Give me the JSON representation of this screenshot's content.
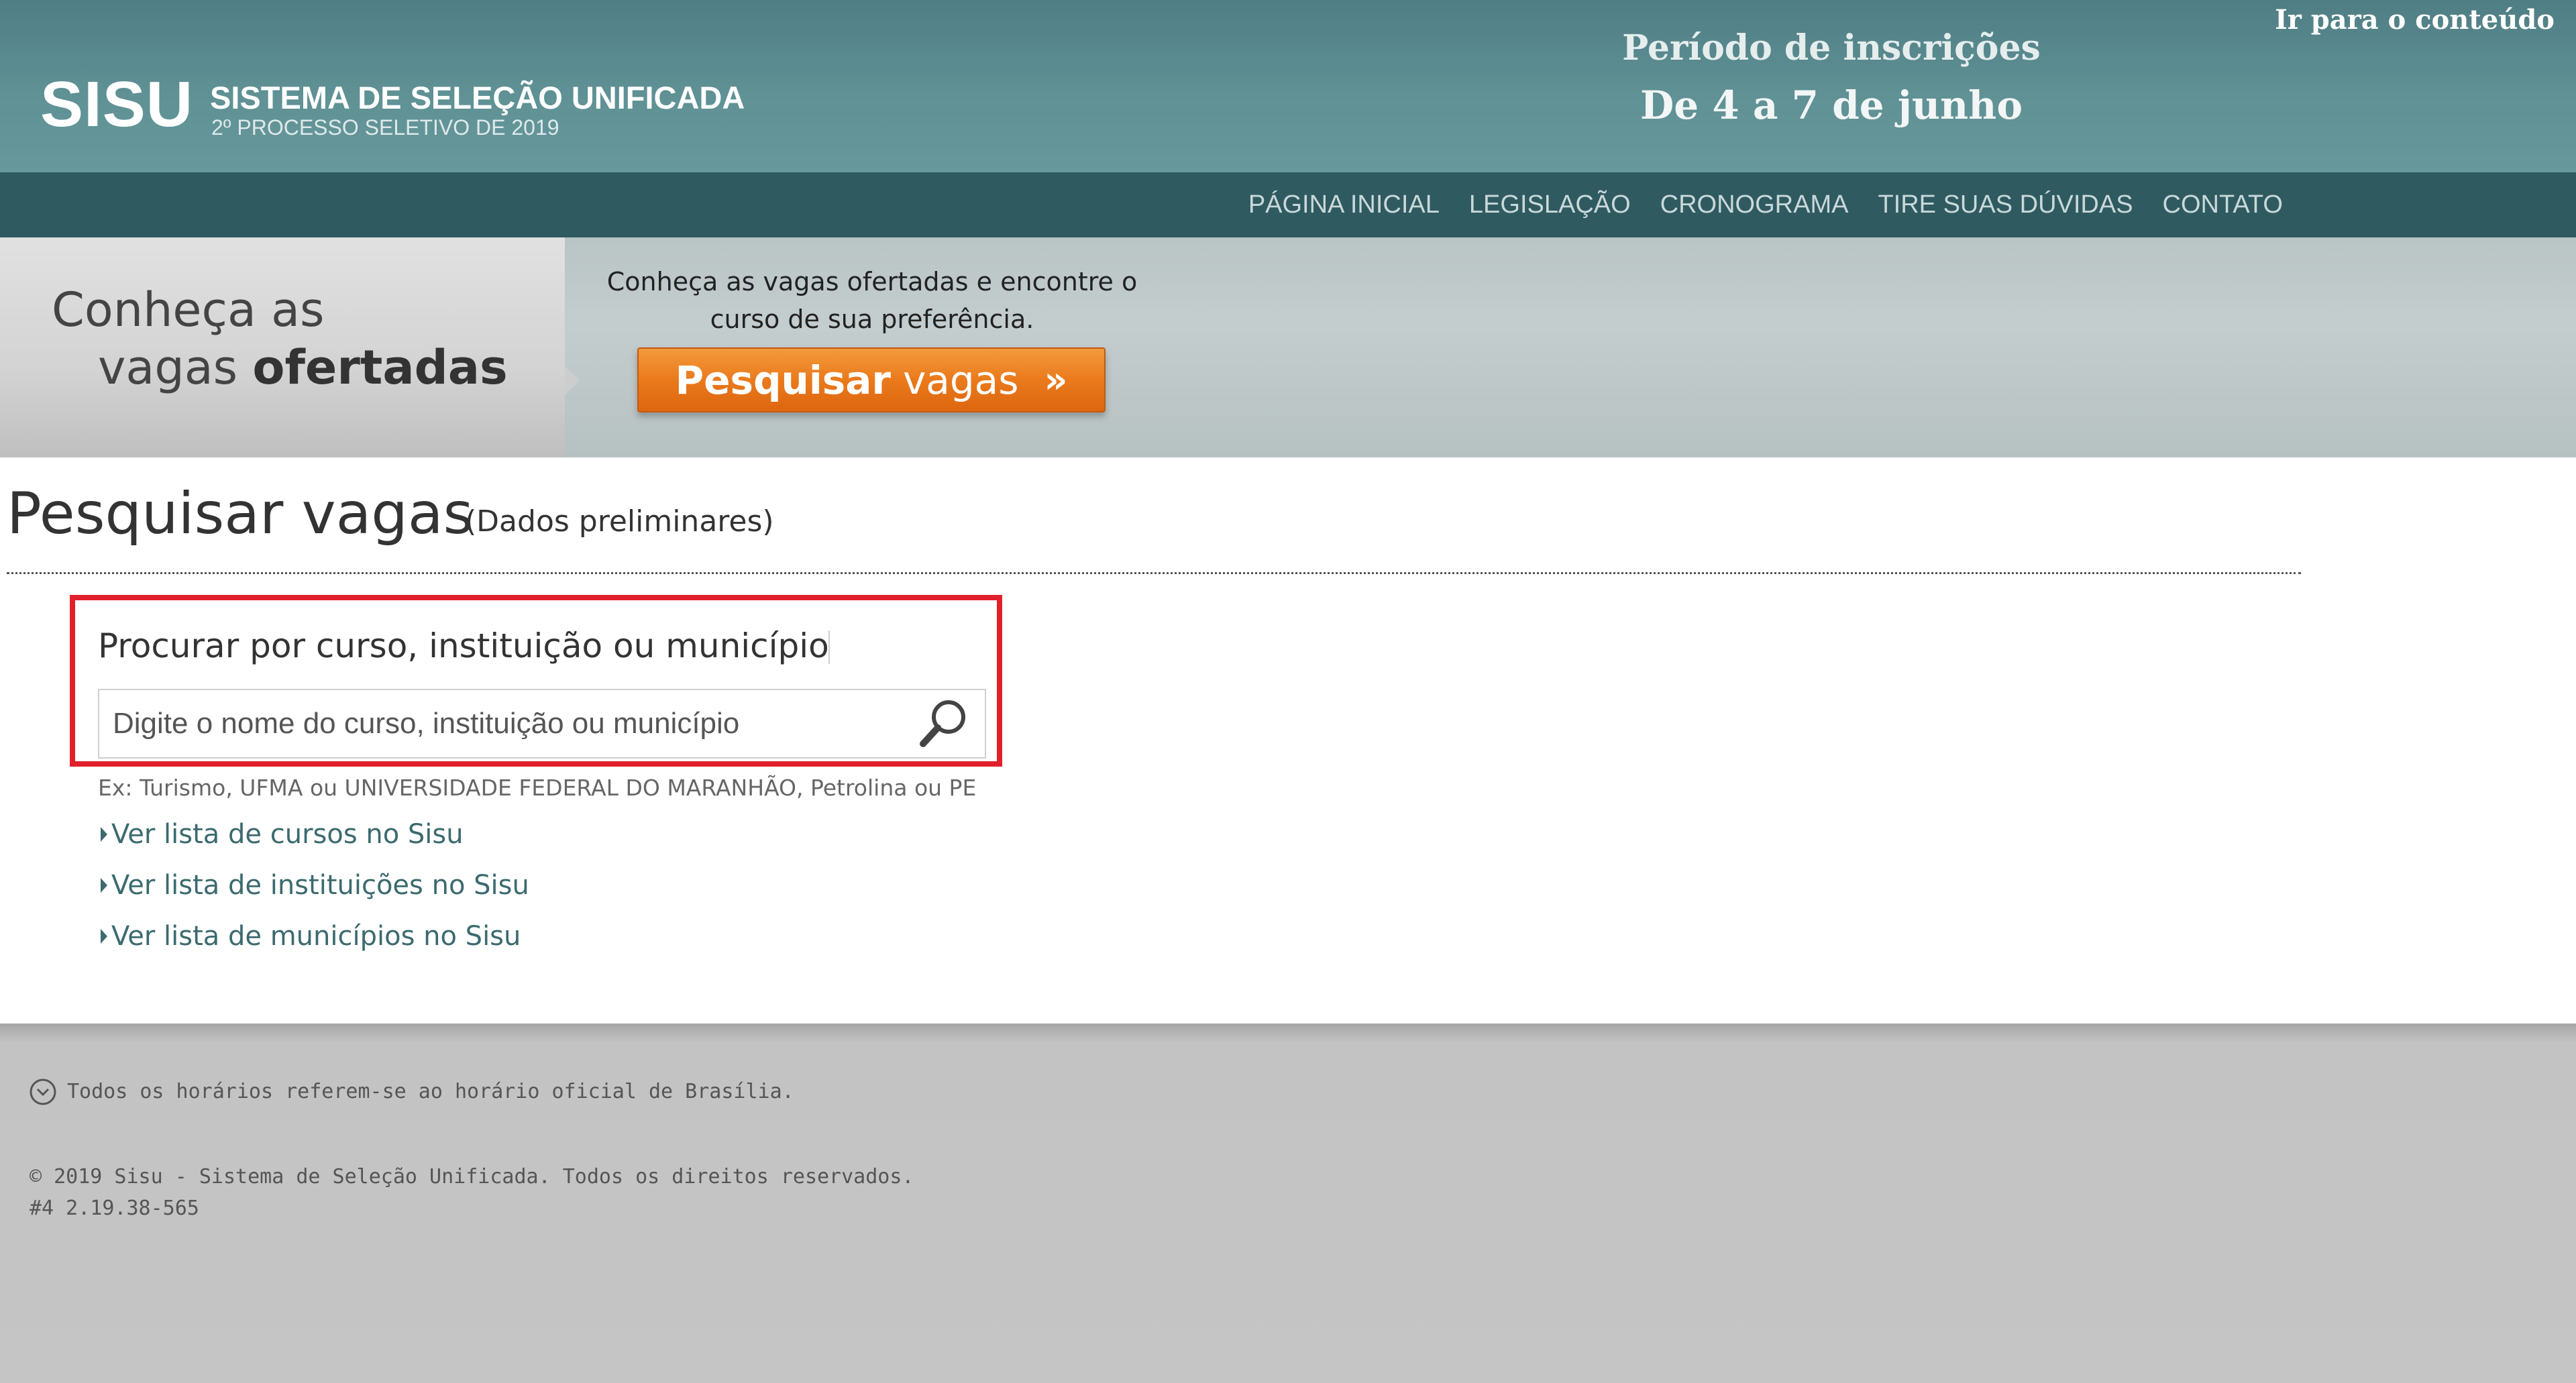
{
  "header": {
    "logo_text": "SISU",
    "system_name": "SISTEMA DE SELEÇÃO UNIFICADA",
    "process_subtitle": "2º PROCESSO SELETIVO DE 2019",
    "period_label": "Período de inscrições",
    "period_dates": "De 4 a 7 de junho",
    "skip_link": "Ir para o conteúdo"
  },
  "nav": {
    "items": [
      {
        "label": "PÁGINA INICIAL"
      },
      {
        "label": "LEGISLAÇÃO"
      },
      {
        "label": "CRONOGRAMA"
      },
      {
        "label": "TIRE SUAS DÚVIDAS"
      },
      {
        "label": "CONTATO"
      }
    ]
  },
  "banner": {
    "title_line1": "Conheça as",
    "title_line2_prefix": "vagas ",
    "title_line2_bold": "ofertadas",
    "description": "Conheça as vagas ofertadas e encontre o curso de sua preferência.",
    "button_bold": "Pesquisar",
    "button_light": "vagas",
    "button_arrows": "»"
  },
  "main": {
    "page_title": "Pesquisar vagas",
    "page_title_note": "(Dados preliminares)",
    "search_label": "Procurar por curso, instituição ou município",
    "search_placeholder": "Digite o nome do curso, instituição ou município",
    "search_value": "",
    "search_example": "Ex: Turismo, UFMA ou UNIVERSIDADE FEDERAL DO MARANHÃO, Petrolina ou PE",
    "links": [
      {
        "label": "Ver lista de cursos no Sisu"
      },
      {
        "label": "Ver lista de instituições no Sisu"
      },
      {
        "label": "Ver lista de municípios no Sisu"
      }
    ]
  },
  "footer": {
    "timezone_note": "Todos os horários referem-se ao horário oficial de Brasília.",
    "copyright": "© 2019 Sisu - Sistema de Seleção Unificada. Todos os direitos reservados.",
    "version": "#4  2.19.38-565"
  },
  "icons": {
    "search": "magnifier-icon",
    "clock": "clock-icon",
    "bullet": "triangle-right-icon"
  },
  "colors": {
    "header_bg": "#5f9195",
    "nav_bg": "#2f5a60",
    "cta_orange": "#ea7a1c",
    "highlight_red": "#e0202a",
    "link_teal": "#3c6a6f",
    "footer_bg": "#c5c5c5"
  }
}
